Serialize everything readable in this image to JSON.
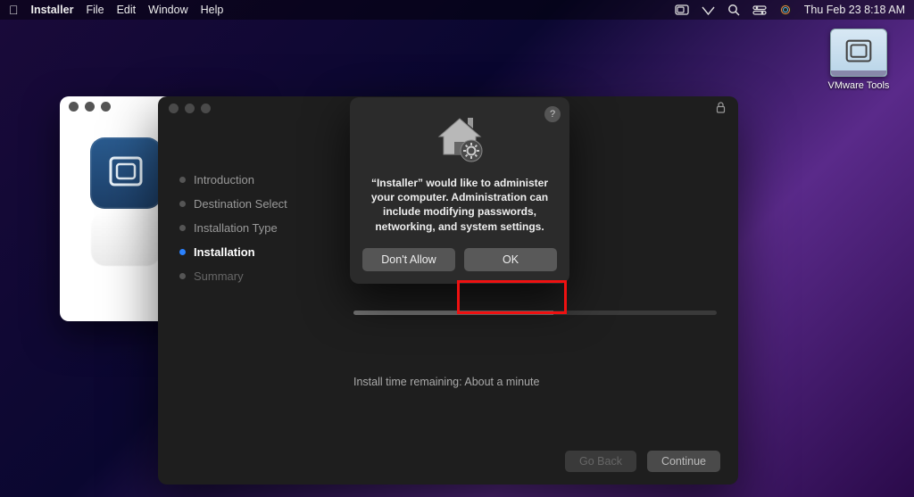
{
  "menubar": {
    "app": "Installer",
    "items": [
      "File",
      "Edit",
      "Window",
      "Help"
    ],
    "clock": "Thu Feb 23  8:18 AM"
  },
  "desktop": {
    "vmware_label": "VMware Tools"
  },
  "installer": {
    "steps": {
      "introduction": "Introduction",
      "destination": "Destination Select",
      "type": "Installation Type",
      "installation": "Installation",
      "summary": "Summary"
    },
    "status": "Install time remaining: About a minute",
    "go_back": "Go Back",
    "continue": "Continue"
  },
  "dialog": {
    "message": "“Installer” would like to administer your computer. Administration can include modifying passwords, networking, and system settings.",
    "dont_allow": "Don't Allow",
    "ok": "OK",
    "help": "?"
  }
}
